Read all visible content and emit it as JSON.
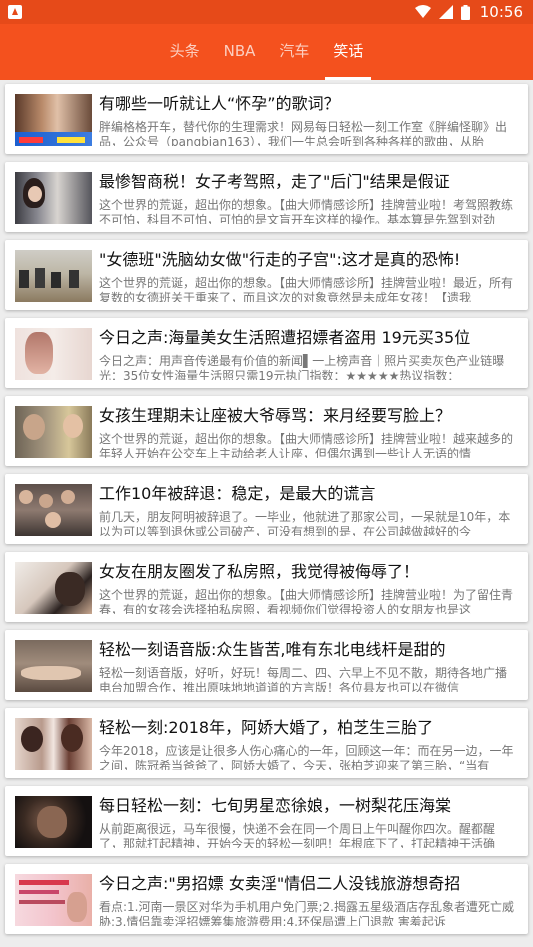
{
  "status_bar": {
    "time": "10:56"
  },
  "tabs": [
    {
      "label": "头条",
      "active": false
    },
    {
      "label": "NBA",
      "active": false
    },
    {
      "label": "汽车",
      "active": false
    },
    {
      "label": "笑话",
      "active": true
    }
  ],
  "news": [
    {
      "title": "有哪些一听就让人“怀孕”的歌词？",
      "desc": "胖编格格开车，替代你的生理需求！网易每日轻松一刻工作室《胖编怪聊》出品，公众号（pangbian163），我们一生总会听到各种各样的歌曲，从胎"
    },
    {
      "title": "最惨智商税！女子考驾照，走了\"后门\"结果是假证",
      "desc": "这个世界的荒诞，超出你的想象。【曲大师情感诊所】挂牌营业啦！考驾照教练不可怕，科目不可怕，可怕的是文盲开车这样的操作。基本算是先驾到对劲"
    },
    {
      "title": "\"女德班\"洗脑幼女做\"行走的子宫\":这才是真的恐怖!",
      "desc": "这个世界的荒诞，超出你的想象。【曲大师情感诊所】挂牌营业啦！最近，所有复数的女德班关于重来了，而且这次的对象竟然是未成年女孩！【遗我"
    },
    {
      "title": "今日之声:海量美女生活照遭招嫖者盗用 19元买35位",
      "desc": "今日之声：用声音传递最有价值的新闻▌一上榜声音｜照片买卖灰色产业链曝光：35位女性海量生活照只需19元执门指数：★★★★★热议指数："
    },
    {
      "title": "女孩生理期未让座被大爷辱骂：来月经要写脸上？",
      "desc": "这个世界的荒诞，超出你的想象。【曲大师情感诊所】挂牌营业啦！越来越多的年轻人开始在公交车上主动给老人让座，但偶尔遇到一些让人无语的情"
    },
    {
      "title": "工作10年被辞退：稳定，是最大的谎言",
      "desc": "前几天，朋友阿明被辞退了。一毕业，他就进了那家公司，一呆就是10年，本以为可以等到退休或公司破产，可没有想到的是，在公司越做越好的今"
    },
    {
      "title": "女友在朋友圈发了私房照，我觉得被侮辱了！",
      "desc": "这个世界的荒诞，超出你的想象。【曲大师情感诊所】挂牌营业啦！为了留住青春，有的女孩会选择拍私房照，看视频你们觉得投资人的女朋友也是这"
    },
    {
      "title": "轻松一刻语音版:众生皆苦,唯有东北电线杆是甜的",
      "desc": "轻松一刻语音版，好听，好玩！每周二、四、六早上不见不散，期待各地广播电台加盟合作，推出原味地地道道的方言版！各位县友也可以在微信"
    },
    {
      "title": "轻松一刻:2018年，阿娇大婚了，柏芝生三胎了",
      "desc": "今年2018，应该是让很多人伤心痛心的一年，回顾这一年：而在另一边，一年之间，陈冠希当爸爸了，阿娇大婚了，今天，张柏芝迎来了第三胎，“当有"
    },
    {
      "title": "每日轻松一刻：七旬男星恋徐娘，一树梨花压海棠",
      "desc": "从前距离很远，马车很慢，快递不会在同一个周日上午叫醒你四次。醒都醒了，那就打起精神，开始今天的轻松一刻吧！年根底下了，打起精神干活确"
    },
    {
      "title": "今日之声:\"男招嫖 女卖淫\"情侣二人没钱旅游想奇招",
      "desc": "看点:1.河南一景区对华为手机用户免门票;2.揭露五星级酒店存乱象者遭死亡威胁;3.情侣靠卖淫招嫖筹集旅游费用;4.环保局遭上门退款 害羞起诉"
    }
  ]
}
